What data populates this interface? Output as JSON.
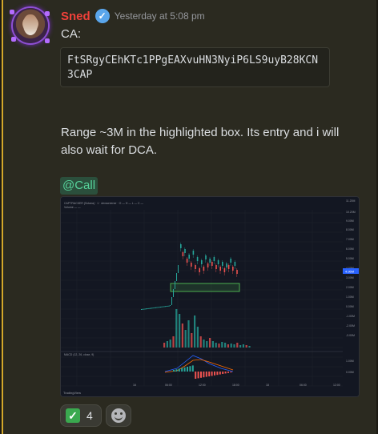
{
  "message": {
    "username": "Sned",
    "timestamp": "Yesterday at 5:08 pm",
    "line1": "CA:",
    "code": "FtSRgyCEhKTc1PPgEAXvuHN3NyiP6LS9uyB28KCN3CAP",
    "text": "Range ~3M in the highlighted box. Its entry and i will also wait for DCA.",
    "mention": "@Call"
  },
  "reactions": [
    {
      "emoji_icon": "check-mark-icon",
      "count": "4"
    }
  ],
  "colors": {
    "username": "#f0413a",
    "mention_bg": "#2b4f3c",
    "mention_fg": "#57d39b",
    "chart_bg": "#131722",
    "candle_up": "#26a69a",
    "candle_down": "#ef5350",
    "highlight_box": "#4caf50"
  },
  "chart": {
    "price_labels": [
      "11.20M",
      "10.20M",
      "9.00M",
      "8.00M",
      "7.00M",
      "6.00M",
      "5.00M",
      "4.00M",
      "3.00M",
      "2.00M",
      "1.00M",
      "0.00M",
      "-1.00M",
      "-2.00M",
      "-3.00M",
      "1.00M",
      "0.00M"
    ],
    "time_labels": [
      "16",
      "06:00",
      "12:00",
      "18:00",
      "18",
      "06:00",
      "12:00"
    ],
    "current_price_label": "4.96M",
    "watermark": "TradingView"
  }
}
